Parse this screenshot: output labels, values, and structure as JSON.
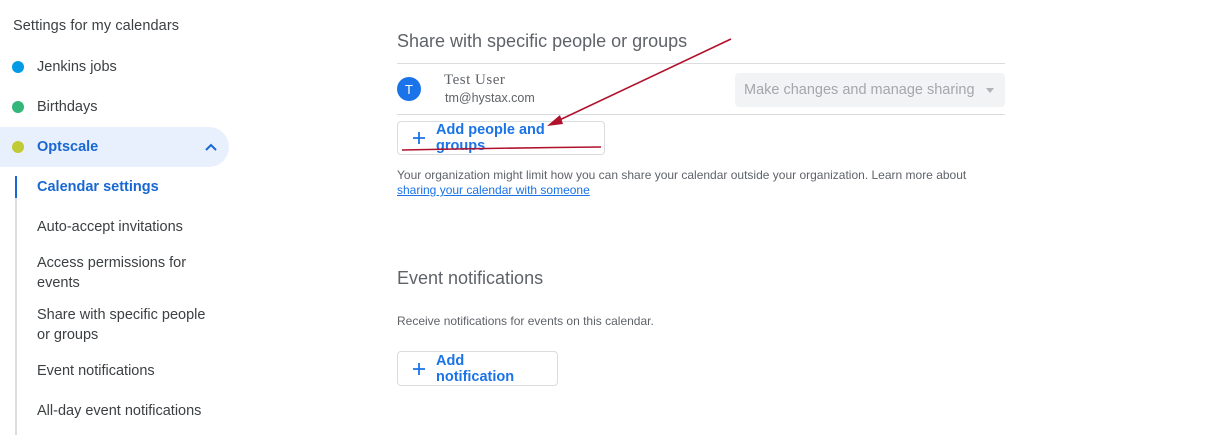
{
  "sidebar": {
    "heading": "Settings for my calendars",
    "calendars": [
      {
        "label": "Jenkins jobs",
        "color": "#039be5"
      },
      {
        "label": "Birthdays",
        "color": "#33b679"
      },
      {
        "label": "Optscale",
        "color": "#c0ca33"
      }
    ],
    "sub_items": [
      {
        "label": "Calendar settings"
      },
      {
        "label": "Auto-accept invitations"
      },
      {
        "label": "Access permissions for events"
      },
      {
        "label": "Share with specific people or groups"
      },
      {
        "label": "Event notifications"
      },
      {
        "label": "All-day event notifications"
      }
    ]
  },
  "share": {
    "title": "Share with specific people or groups",
    "person": {
      "initial": "T",
      "name": "Test  User",
      "email": "tm@hystax.com",
      "permission": "Make changes and manage sharing"
    },
    "add_button": "Add people and groups",
    "info_text": "Your organization might limit how you can share your calendar outside your organization. Learn more about",
    "info_link": "sharing your calendar with someone"
  },
  "notifications": {
    "title": "Event notifications",
    "description": "Receive notifications for events on this calendar.",
    "add_button": "Add notification"
  },
  "colors": {
    "accent": "#1a73e8",
    "active_text": "#1967d2",
    "active_bg": "#e8f0fe",
    "annotation": "#b0122c"
  }
}
